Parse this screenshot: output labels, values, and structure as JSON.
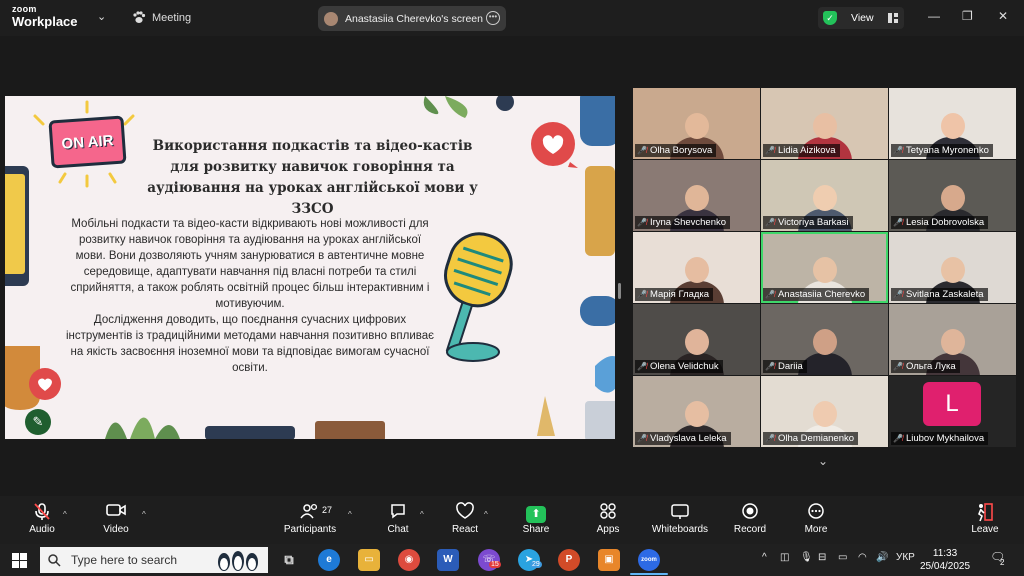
{
  "app": {
    "brand_small": "zoom",
    "brand_large": "Workplace"
  },
  "topbar": {
    "meeting_label": "Meeting",
    "screen_share_label": "Anastasiia Cherevko's screen",
    "view_label": "View"
  },
  "slide": {
    "onair": "ON AIR",
    "title": "Використання подкастів та відео-кастів для розвитку навичок говоріння та аудіювання на уроках англійської мови у ЗЗСО",
    "body_p1": "Мобільні подкасти та відео-касти відкривають нові можливості для розвитку навичок говоріння та аудіювання на уроках англійської мови. Вони дозволяють учням занурюватися в автентичне мовне середовище, адаптувати навчання під власні потреби та стилі сприйняття, а також роблять освітній процес більш інтерактивним і мотивуючим.",
    "body_p2": "Дослідження доводить, що поєднання сучасних цифрових інструментів із традиційними методами навчання позитивно впливає на якість засвоєння іноземної мови та відповідає вимогам сучасної освіти."
  },
  "participants": [
    {
      "name": "Olha Borysova",
      "bg": "#c9a98e",
      "skin": "#e3b99a",
      "shirt": "#6e4a3c"
    },
    {
      "name": "Lidia Aizikova",
      "bg": "#d7c6b3",
      "skin": "#e8bfa3",
      "shirt": "#b1343f"
    },
    {
      "name": "Tetyana Myronenko",
      "bg": "#e7e2dc",
      "skin": "#efc4a8",
      "shirt": "#2f2f38"
    },
    {
      "name": "Iryna Shevchenko",
      "bg": "#8a7a74",
      "skin": "#e0b698",
      "shirt": "#3a3340"
    },
    {
      "name": "Victoriya Barkasi",
      "bg": "#cfc7b5",
      "skin": "#efcdb0",
      "shirt": "#4e5a6e"
    },
    {
      "name": "Lesia Dobrovolska",
      "bg": "#5c5a55",
      "skin": "#d7a98c",
      "shirt": "#2a2a2e"
    },
    {
      "name": "Марія Гладка",
      "bg": "#e8ded6",
      "skin": "#e6bda1",
      "shirt": "#5a3e34"
    },
    {
      "name": "Anastasiia Cherevko",
      "bg": "#bdb4a6",
      "skin": "#e6c2a5",
      "shirt": "#e8e4de"
    },
    {
      "name": "Svitlana Zaskaleta",
      "bg": "#ded9d3",
      "skin": "#e8c2a5",
      "shirt": "#2b2b30"
    },
    {
      "name": "Olena Velidchuk",
      "bg": "#4f4c49",
      "skin": "#e0b49a",
      "shirt": "#2a2424"
    },
    {
      "name": "Dariia",
      "bg": "#6c6762",
      "skin": "#cfa086",
      "shirt": "#24232a"
    },
    {
      "name": "Ольга Лука",
      "bg": "#a9a198",
      "skin": "#dfb59a",
      "shirt": "#44363a"
    },
    {
      "name": "Vladyslava Leleka",
      "bg": "#b9ada0",
      "skin": "#e6bea2",
      "shirt": "#2e2a2c"
    },
    {
      "name": "Olha Demianenko",
      "bg": "#e3dcd2",
      "skin": "#efcbb0",
      "shirt": "#f0ece6"
    },
    {
      "name": "Liubov Mykhailova",
      "bg": "#252525",
      "avatar_letter": "L",
      "avatar_color": "#e0206e"
    }
  ],
  "toolbar": {
    "audio": "Audio",
    "video": "Video",
    "participants": "Participants",
    "participants_count": "27",
    "chat": "Chat",
    "react": "React",
    "share": "Share",
    "apps": "Apps",
    "whiteboards": "Whiteboards",
    "record": "Record",
    "more": "More",
    "leave": "Leave"
  },
  "taskbar": {
    "search_placeholder": "Type here to search",
    "viber_badge": "15",
    "telegram_badge": "29",
    "language": "УКР",
    "time": "11:33",
    "date": "25/04/2025",
    "notifications": "2"
  },
  "icons": {
    "mic_off": "mic-off-icon",
    "shield": "shield-check-icon"
  }
}
